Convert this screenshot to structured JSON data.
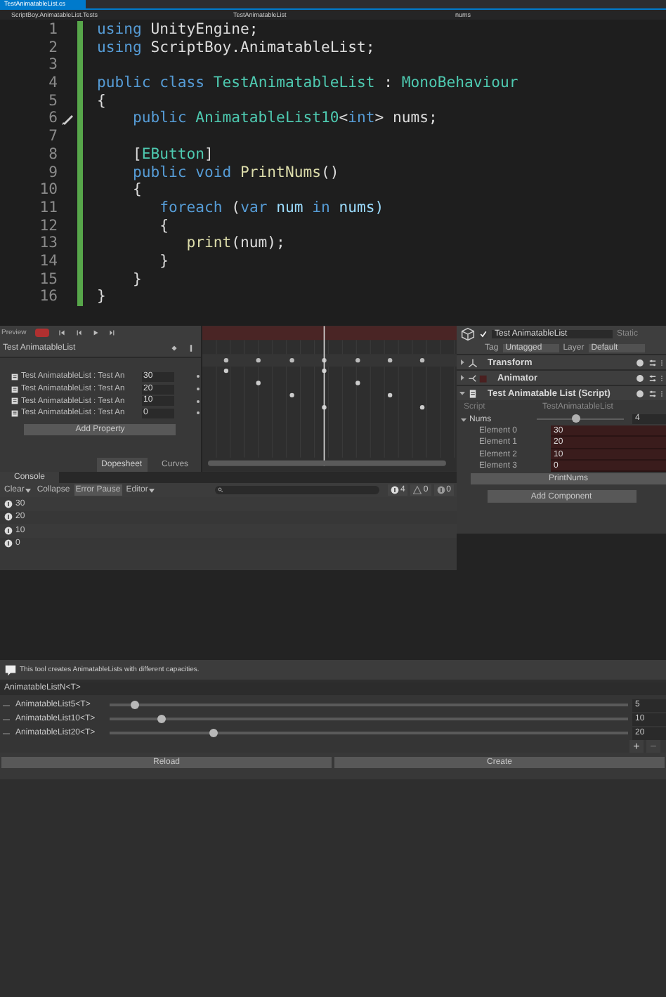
{
  "editor": {
    "tab": "TestAnimatableList.cs",
    "nav": [
      "ScriptBoy.AnimatableList.Tests",
      "TestAnimatableList",
      "nums"
    ],
    "lines": [
      {
        "number": "1",
        "tokens": [
          {
            "text": "using",
            "kind": "keyword"
          },
          {
            "text": " UnityEngine;",
            "kind": "plain"
          }
        ]
      },
      {
        "number": "2",
        "tokens": [
          {
            "text": "using",
            "kind": "keyword"
          },
          {
            "text": " ScriptBoy.AnimatableList;",
            "kind": "plain"
          }
        ]
      },
      {
        "number": "3"
      },
      {
        "number": "4",
        "tokens": [
          {
            "text": "public class",
            "kind": "keyword"
          },
          {
            "text": " TestAnimatableList",
            "kind": "type"
          },
          {
            "text": " : ",
            "kind": "plain"
          },
          {
            "text": "MonoBehaviour",
            "kind": "type"
          }
        ]
      },
      {
        "number": "5",
        "tokens": [
          {
            "text": "{",
            "kind": "plain"
          }
        ]
      },
      {
        "number": "6",
        "marker": true,
        "tokens": [
          {
            "text": "    public",
            "kind": "keyword"
          },
          {
            "text": " AnimatableList10",
            "kind": "type"
          },
          {
            "text": "<",
            "kind": "plain"
          },
          {
            "text": "int",
            "kind": "keyword"
          },
          {
            "text": "> nums;",
            "kind": "plain"
          }
        ]
      },
      {
        "number": "7"
      },
      {
        "number": "8",
        "tokens": [
          {
            "text": "    [",
            "kind": "plain"
          },
          {
            "text": "EButton",
            "kind": "type"
          },
          {
            "text": "]",
            "kind": "plain"
          }
        ]
      },
      {
        "number": "9",
        "tokens": [
          {
            "text": "    public void",
            "kind": "keyword"
          },
          {
            "text": " PrintNums",
            "kind": "method"
          },
          {
            "text": "()",
            "kind": "plain"
          }
        ]
      },
      {
        "number": "10",
        "tokens": [
          {
            "text": "    {",
            "kind": "plain"
          }
        ]
      },
      {
        "number": "11",
        "tokens": [
          {
            "text": "       foreach",
            "kind": "keyword"
          },
          {
            "text": " (",
            "kind": "plain"
          },
          {
            "text": "var",
            "kind": "keyword"
          },
          {
            "text": " num ",
            "kind": "variable"
          },
          {
            "text": "in",
            "kind": "keyword"
          },
          {
            "text": " nums)",
            "kind": "variable"
          }
        ]
      },
      {
        "number": "12",
        "tokens": [
          {
            "text": "       {",
            "kind": "plain"
          }
        ]
      },
      {
        "number": "13",
        "tokens": [
          {
            "text": "          print",
            "kind": "method"
          },
          {
            "text": "(num);",
            "kind": "plain"
          }
        ]
      },
      {
        "number": "14",
        "tokens": [
          {
            "text": "       }",
            "kind": "plain"
          }
        ]
      },
      {
        "number": "15",
        "tokens": [
          {
            "text": "    }",
            "kind": "plain"
          }
        ]
      },
      {
        "number": "16",
        "tokens": [
          {
            "text": "}",
            "kind": "plain"
          }
        ]
      }
    ]
  },
  "animation": {
    "preview": "Preview",
    "clip": "Test AnimatableList",
    "properties": [
      {
        "name": "Test AnimatableList : Test An",
        "value": "30"
      },
      {
        "name": "Test AnimatableList : Test An",
        "value": "20"
      },
      {
        "name": "Test AnimatableList : Test An",
        "value": "10"
      },
      {
        "name": "Test AnimatableList : Test An",
        "value": "0"
      }
    ],
    "add_property": "Add Property",
    "tabs": [
      {
        "label": "Dopesheet",
        "selected": true
      },
      {
        "label": "Curves",
        "selected": false
      }
    ]
  },
  "inspector": {
    "object": "Test AnimatableList",
    "active": true,
    "static": "Static",
    "tag_label": "Tag",
    "tag": "Untagged",
    "layer_label": "Layer",
    "layer": "Default",
    "components": [
      {
        "name": "Transform",
        "kind": "transform",
        "expanded": false
      },
      {
        "name": "Animator",
        "kind": "animator",
        "expanded": false
      },
      {
        "name": "Test Animatable List (Script)",
        "kind": "script",
        "expanded": true
      }
    ],
    "script_label": "Script",
    "script": "TestAnimatableList",
    "list_label": "Nums",
    "list_expanded": true,
    "level": 0.45,
    "list_size": "4",
    "elements": [
      {
        "label": "Element 0",
        "value": "30"
      },
      {
        "label": "Element 1",
        "value": "20"
      },
      {
        "label": "Element 2",
        "value": "10"
      },
      {
        "label": "Element 3",
        "value": "0"
      }
    ],
    "button": "PrintNums",
    "add_component": "Add Component"
  },
  "console": {
    "title": "Console",
    "toolbar": [
      {
        "label": "Clear",
        "kind": "dropdown",
        "on": false
      },
      {
        "label": "Collapse",
        "kind": "toggle",
        "on": false
      },
      {
        "label": "Error Pause",
        "kind": "toggle",
        "on": true
      },
      {
        "label": "Editor",
        "kind": "dropdown",
        "on": false
      }
    ],
    "counts": [
      {
        "kind": "info",
        "count": "4"
      },
      {
        "kind": "warning",
        "count": "0"
      },
      {
        "kind": "error",
        "count": "0"
      }
    ],
    "logs": [
      "30",
      "20",
      "10",
      "0"
    ]
  },
  "tool": {
    "info": "This tool creates AnimatableLists with different capacities.",
    "header": "AnimatableListN<T>",
    "rows": [
      {
        "label": "AnimatableList5<T>",
        "level": 0.05,
        "value": "5"
      },
      {
        "label": "AnimatableList10<T>",
        "level": 0.1,
        "value": "10"
      },
      {
        "label": "AnimatableList20<T>",
        "level": 0.2,
        "value": "20"
      }
    ],
    "add": "+",
    "remove": "−",
    "buttons": [
      "Reload",
      "Create"
    ]
  }
}
